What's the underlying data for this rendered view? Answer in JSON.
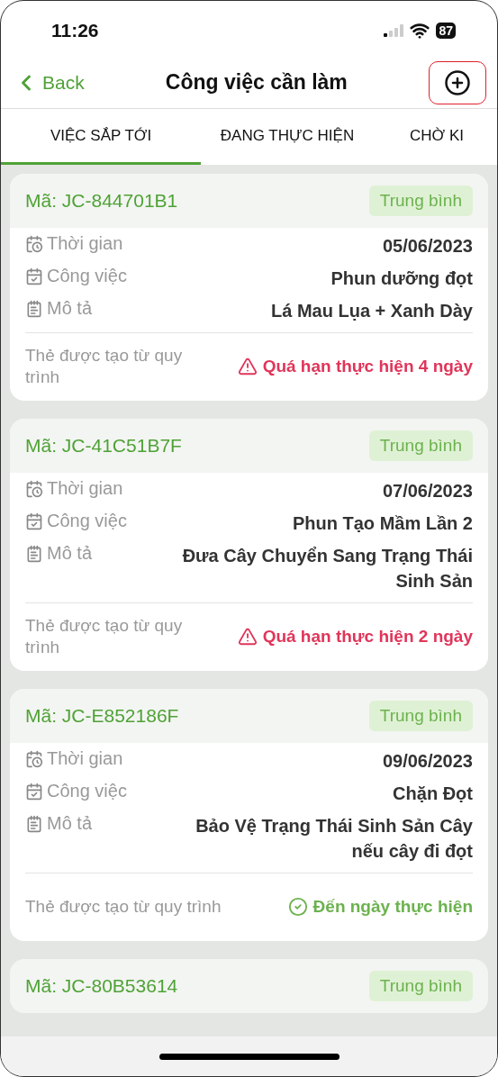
{
  "status_bar": {
    "time": "11:26",
    "battery": "87"
  },
  "nav": {
    "back": "Back",
    "title": "Công việc cần làm"
  },
  "tabs": [
    {
      "label": "VIỆC SẮP TỚI",
      "selected": true
    },
    {
      "label": "ĐANG THỰC HIỆN",
      "selected": false
    },
    {
      "label": "CHỜ KI",
      "selected": false
    }
  ],
  "tasks": [
    {
      "code": "Mã: JC-844701B1",
      "priority": "Trung bình",
      "fields": [
        {
          "kind": "time",
          "label": "Thời gian",
          "value": "05/06/2023"
        },
        {
          "kind": "job",
          "label": "Công việc",
          "value": "Phun dưỡng đọt"
        },
        {
          "kind": "desc",
          "label": "Mô tả",
          "value": "Lá Mau Lụa + Xanh Dày"
        }
      ],
      "note": "Thẻ được tạo từ quy trình",
      "status": {
        "kind": "overdue",
        "text": "Quá hạn thực hiện 4 ngày"
      }
    },
    {
      "code": "Mã: JC-41C51B7F",
      "priority": "Trung bình",
      "fields": [
        {
          "kind": "time",
          "label": "Thời gian",
          "value": "07/06/2023"
        },
        {
          "kind": "job",
          "label": "Công việc",
          "value": "Phun Tạo Mầm Lần 2"
        },
        {
          "kind": "desc",
          "label": "Mô tả",
          "value": "Đưa Cây Chuyển Sang Trạng Thái Sinh Sản"
        }
      ],
      "note": "Thẻ được tạo từ quy trình",
      "status": {
        "kind": "overdue",
        "text": "Quá hạn thực hiện 2 ngày"
      }
    },
    {
      "code": "Mã: JC-E852186F",
      "priority": "Trung bình",
      "fields": [
        {
          "kind": "time",
          "label": "Thời gian",
          "value": "09/06/2023"
        },
        {
          "kind": "job",
          "label": "Công việc",
          "value": "Chặn Đọt"
        },
        {
          "kind": "desc",
          "label": "Mô tả",
          "value": "Bảo Vệ Trạng Thái Sinh Sản Cây nếu cây đi đọt"
        }
      ],
      "note": "Thẻ được tạo từ quy trình",
      "status": {
        "kind": "due",
        "text": "Đến ngày thực hiện"
      }
    },
    {
      "code": "Mã: JC-80B53614",
      "priority": "Trung bình"
    }
  ]
}
